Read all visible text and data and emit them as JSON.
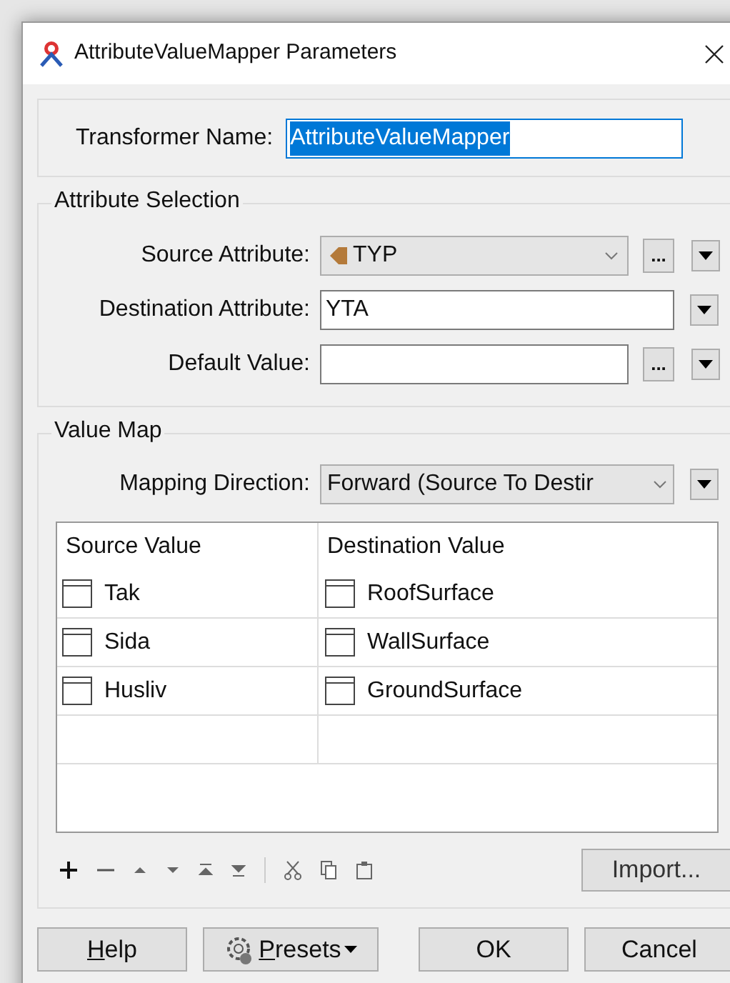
{
  "window": {
    "title": "AttributeValueMapper Parameters"
  },
  "transformer_name": {
    "label": "Transformer Name:",
    "value": "AttributeValueMapper",
    "selected": true
  },
  "attribute_selection": {
    "title": "Attribute Selection",
    "fields": [
      {
        "kind": "combo",
        "label": "Source Attribute:",
        "value": "TYP",
        "more": "...",
        "attr_icon": true
      },
      {
        "kind": "text",
        "label": "Destination Attribute:",
        "value": "YTA"
      },
      {
        "kind": "textmore",
        "label": "Default Value:",
        "more": "..."
      }
    ]
  },
  "value_map": {
    "title": "Value Map",
    "direction": {
      "label": "Mapping Direction:",
      "value": "Forward (Source To Destir"
    },
    "table": {
      "columns": [
        "Source Value",
        "Destination Value"
      ],
      "rows": [
        {
          "source": "Tak",
          "destination": "RoofSurface"
        },
        {
          "source": "Sida",
          "destination": "WallSurface"
        },
        {
          "source": "Husliv",
          "destination": "GroundSurface"
        }
      ]
    },
    "import_button": "Import..."
  },
  "buttons": [
    {
      "kind": "plain",
      "label": "Help",
      "mnemonic": true
    },
    {
      "kind": "menu",
      "label": "Presets",
      "mnemonic": true
    },
    {
      "kind": "plain",
      "label": "OK",
      "mnemonic": false
    },
    {
      "kind": "plain",
      "label": "Cancel",
      "mnemonic": false
    }
  ]
}
